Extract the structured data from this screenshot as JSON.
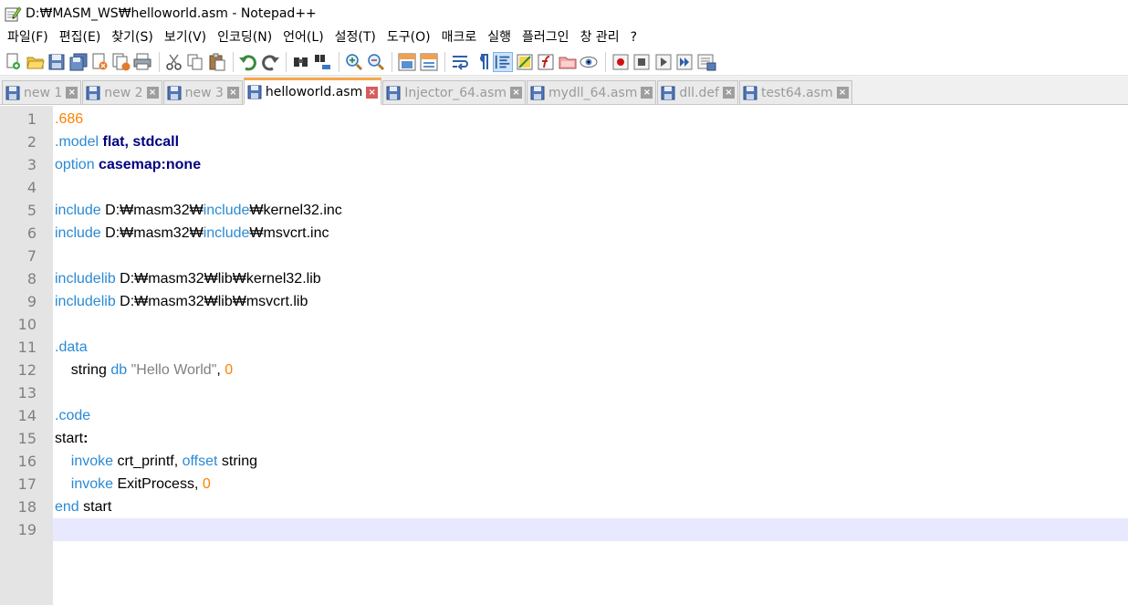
{
  "window": {
    "title": "D:₩MASM_WS₩helloworld.asm - Notepad++"
  },
  "menu": [
    "파일(F)",
    "편집(E)",
    "찾기(S)",
    "보기(V)",
    "인코딩(N)",
    "언어(L)",
    "설정(T)",
    "도구(O)",
    "매크로",
    "실행",
    "플러그인",
    "창 관리",
    "?"
  ],
  "toolbar_icons": [
    "new-file-icon",
    "open-file-icon",
    "save-icon",
    "save-all-icon",
    "close-icon",
    "close-all-icon",
    "print-icon",
    "cut-icon",
    "copy-icon",
    "paste-icon",
    "undo-icon",
    "redo-icon",
    "find-icon",
    "replace-icon",
    "zoom-in-icon",
    "zoom-out-icon",
    "sync-vertical-icon",
    "sync-horizontal-icon",
    "word-wrap-icon",
    "show-all-chars-icon",
    "indent-guide-icon",
    "document-map-icon",
    "function-list-icon",
    "folder-workspace-icon",
    "monitoring-icon",
    "record-macro-icon",
    "stop-macro-icon",
    "play-macro-icon",
    "run-macro-multiple-icon",
    "save-macro-icon"
  ],
  "tabs": [
    {
      "label": "new 1",
      "close": "×",
      "active": false
    },
    {
      "label": "new 2",
      "close": "×",
      "active": false
    },
    {
      "label": "new 3",
      "close": "×",
      "active": false
    },
    {
      "label": "helloworld.asm",
      "close": "×",
      "active": true
    },
    {
      "label": "Injector_64.asm",
      "close": "×",
      "active": false
    },
    {
      "label": "mydll_64.asm",
      "close": "×",
      "active": false
    },
    {
      "label": "dll.def",
      "close": "×",
      "active": false
    },
    {
      "label": "test64.asm",
      "close": "×",
      "active": false
    }
  ],
  "editor": {
    "current_line": 19,
    "lines": [
      {
        "num": "1",
        "tokens": [
          {
            "t": ".686",
            "c": "num"
          }
        ]
      },
      {
        "num": "2",
        "tokens": [
          {
            "t": ".model",
            "c": "dir"
          },
          {
            "t": " ",
            "c": "plain"
          },
          {
            "t": "flat, stdcall",
            "c": "kw"
          }
        ]
      },
      {
        "num": "3",
        "tokens": [
          {
            "t": "option",
            "c": "dir"
          },
          {
            "t": " ",
            "c": "plain"
          },
          {
            "t": "casemap:none",
            "c": "kw"
          }
        ]
      },
      {
        "num": "4",
        "tokens": []
      },
      {
        "num": "5",
        "tokens": [
          {
            "t": "include",
            "c": "dir"
          },
          {
            "t": " D:₩masm32₩",
            "c": "plain"
          },
          {
            "t": "include",
            "c": "dir"
          },
          {
            "t": "₩kernel32.inc",
            "c": "plain"
          }
        ]
      },
      {
        "num": "6",
        "tokens": [
          {
            "t": "include",
            "c": "dir"
          },
          {
            "t": " D:₩masm32₩",
            "c": "plain"
          },
          {
            "t": "include",
            "c": "dir"
          },
          {
            "t": "₩msvcrt.inc",
            "c": "plain"
          }
        ]
      },
      {
        "num": "7",
        "tokens": []
      },
      {
        "num": "8",
        "tokens": [
          {
            "t": "includelib",
            "c": "dir"
          },
          {
            "t": " D:₩masm32₩lib₩kernel32.lib",
            "c": "plain"
          }
        ]
      },
      {
        "num": "9",
        "tokens": [
          {
            "t": "includelib",
            "c": "dir"
          },
          {
            "t": " D:₩masm32₩lib₩msvcrt.lib",
            "c": "plain"
          }
        ]
      },
      {
        "num": "10",
        "tokens": []
      },
      {
        "num": "11",
        "tokens": [
          {
            "t": ".data",
            "c": "dir"
          }
        ]
      },
      {
        "num": "12",
        "tokens": [
          {
            "t": "    string ",
            "c": "plain"
          },
          {
            "t": "db",
            "c": "dir"
          },
          {
            "t": " ",
            "c": "plain"
          },
          {
            "t": "\"Hello World\"",
            "c": "str"
          },
          {
            "t": ", ",
            "c": "plain"
          },
          {
            "t": "0",
            "c": "num"
          }
        ]
      },
      {
        "num": "13",
        "tokens": []
      },
      {
        "num": "14",
        "tokens": [
          {
            "t": ".code",
            "c": "dir"
          }
        ]
      },
      {
        "num": "15",
        "tokens": [
          {
            "t": "start",
            "c": "plain"
          },
          {
            "t": ":",
            "c": "op"
          }
        ]
      },
      {
        "num": "16",
        "tokens": [
          {
            "t": "    ",
            "c": "plain"
          },
          {
            "t": "invoke",
            "c": "dir"
          },
          {
            "t": " crt_printf, ",
            "c": "plain"
          },
          {
            "t": "offset",
            "c": "dir"
          },
          {
            "t": " string",
            "c": "plain"
          }
        ]
      },
      {
        "num": "17",
        "tokens": [
          {
            "t": "    ",
            "c": "plain"
          },
          {
            "t": "invoke",
            "c": "dir"
          },
          {
            "t": " ExitProcess, ",
            "c": "plain"
          },
          {
            "t": "0",
            "c": "num"
          }
        ]
      },
      {
        "num": "18",
        "tokens": [
          {
            "t": "end",
            "c": "dir"
          },
          {
            "t": " start",
            "c": "plain"
          }
        ]
      },
      {
        "num": "19",
        "tokens": []
      }
    ]
  },
  "colors": {
    "directive": "#2a8ad4",
    "number": "#ff8000",
    "keyword": "#000080",
    "string": "#808080",
    "active_tab_accent": "#f7a94b",
    "current_line_bg": "#e8e8ff",
    "gutter_bg": "#e4e4e4"
  }
}
